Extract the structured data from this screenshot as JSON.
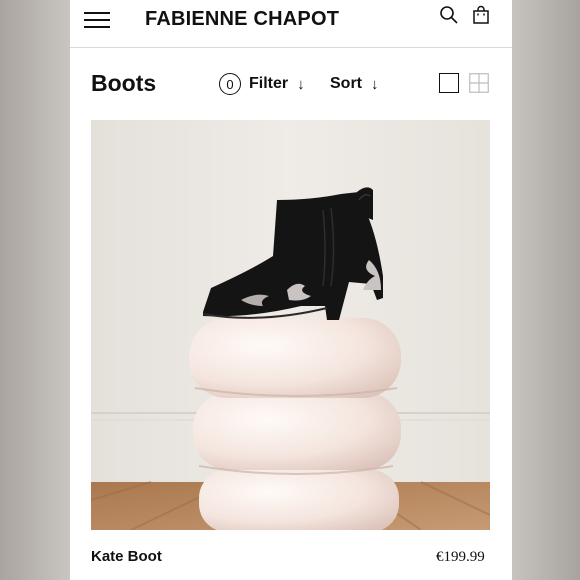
{
  "header": {
    "brand": "FABIENNE CHAPOT",
    "icons": {
      "menu": "hamburger-menu-icon",
      "search": "search-icon",
      "cart": "shopping-bag-icon"
    }
  },
  "toolbar": {
    "title": "Boots",
    "filter_count": "0",
    "filter_label": "Filter",
    "filter_arrow": "↓",
    "sort_label": "Sort",
    "sort_arrow": "↓",
    "view_modes": [
      "single-column-view-icon",
      "grid-view-icon"
    ]
  },
  "product": {
    "name": "Kate Boot",
    "price": "€199.99",
    "image_icon": "ankle-boot-on-pedestal"
  },
  "colors": {
    "text": "#111111",
    "background": "#ffffff",
    "pedestal": "#f5e9e3",
    "wall": "#ebe7e1",
    "floor": "#b98a64"
  }
}
